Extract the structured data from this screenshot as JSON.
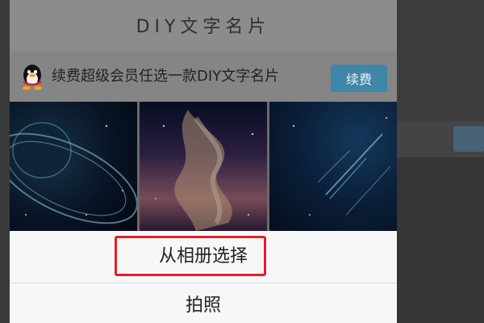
{
  "header": {
    "title": "DIY文字名片"
  },
  "promo": {
    "icon": "qq-penguin-icon",
    "text": "续费超级会员任选一款DIY文字名片",
    "button_label": "续费",
    "button_color": "#3f86a8"
  },
  "gallery": {
    "items": [
      {
        "name": "planet-ring-card"
      },
      {
        "name": "nebula-card"
      },
      {
        "name": "meteor-card"
      }
    ]
  },
  "action_sheet": {
    "choose_from_album": "从相册选择",
    "take_photo": "拍照",
    "highlight_color": "#e0202a"
  }
}
